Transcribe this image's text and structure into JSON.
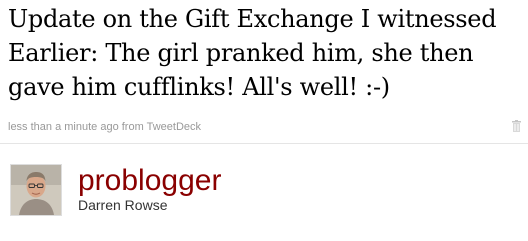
{
  "tweet": {
    "lines": [
      "Update on the Gift Exchange I witnessed",
      "Earlier: The girl pranked him, she then",
      "gave him cufflinks! All's well! :-)"
    ],
    "timestamp": "less than a minute ago",
    "from_label": "from",
    "source": "TweetDeck"
  },
  "author": {
    "screen_name": "problogger",
    "full_name": "Darren Rowse",
    "avatar_icon": "user-photo-avatar"
  },
  "colors": {
    "screen_name": "#8a0000",
    "meta_text": "#999999",
    "tweet_text": "#000000"
  }
}
